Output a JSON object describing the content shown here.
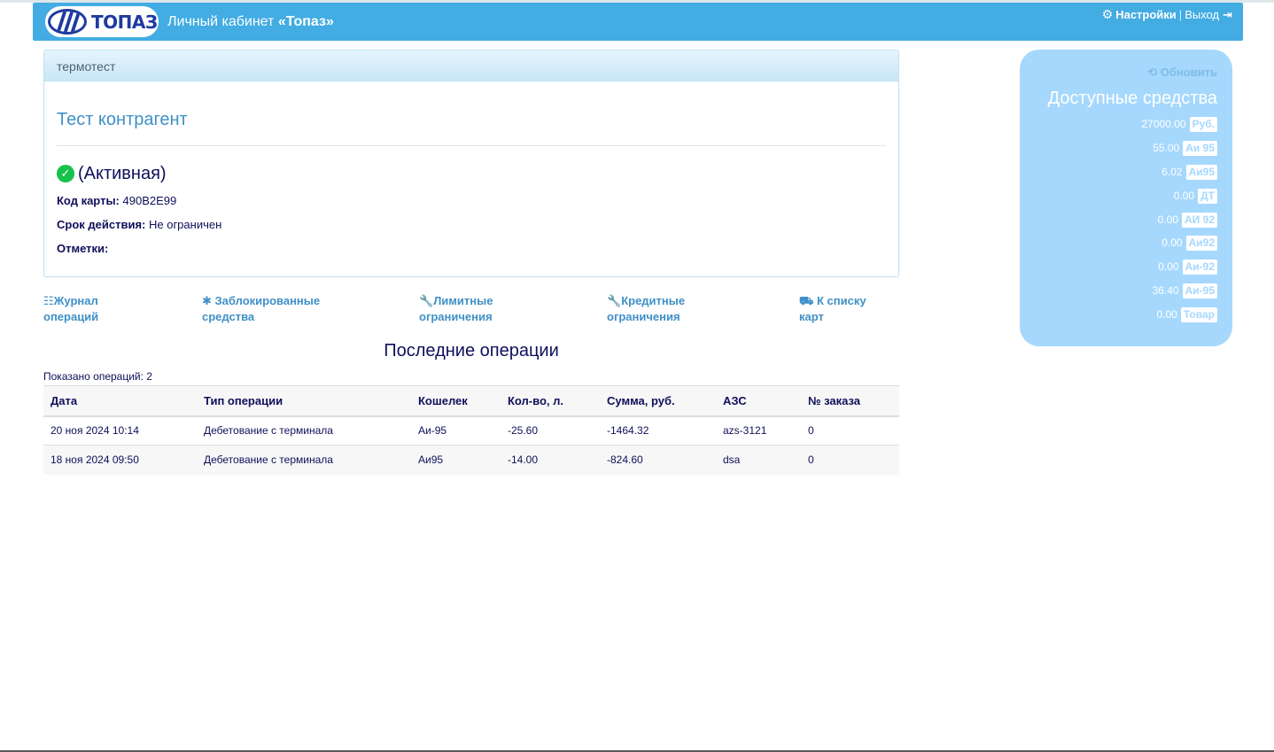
{
  "header": {
    "logo_text": "ТОПАЗ",
    "brand_prefix": "Личный кабинет ",
    "brand_name": "«Топаз»",
    "settings_label": "Настройки",
    "separator": "|",
    "logout_label": "Выход"
  },
  "card": {
    "group_name": "термотест",
    "contractor": "Тест контрагент",
    "status": "(Активная)",
    "code_label": "Код карты:",
    "code_value": "490B2E99",
    "validity_label": "Срок действия:",
    "validity_value": "Не ограничен",
    "notes_label": "Отметки:",
    "notes_value": ""
  },
  "actions": [
    {
      "icon": "list-icon",
      "line1": "Журнал",
      "line2": "операций"
    },
    {
      "icon": "asterisk-icon",
      "line1": "Заблокированные",
      "line2": "средства"
    },
    {
      "icon": "wrench-icon",
      "line1": "Лимитные",
      "line2": "ограничения"
    },
    {
      "icon": "wrench-icon",
      "line1": "Кредитные",
      "line2": "ограничения"
    },
    {
      "icon": "truck-icon",
      "line1": "К списку",
      "line2": "карт"
    }
  ],
  "operations": {
    "title": "Последние операции",
    "count_text": "Показано операций: 2",
    "columns": [
      "Дата",
      "Тип операции",
      "Кошелек",
      "Кол-во, л.",
      "Сумма, руб.",
      "АЗС",
      "№ заказа"
    ],
    "rows": [
      [
        "20 ноя 2024 10:14",
        "Дебетование с терминала",
        "Аи-95",
        "-25.60",
        "-1464.32",
        "azs-3121",
        "0"
      ],
      [
        "18 ноя 2024 09:50",
        "Дебетование с терминала",
        "Аи95",
        "-14.00",
        "-824.60",
        "dsa",
        "0"
      ]
    ]
  },
  "funds": {
    "refresh_label": "Обновить",
    "title": "Доступные средства",
    "items": [
      {
        "amount": "27000.00",
        "label": "Руб."
      },
      {
        "amount": "55.00",
        "label": "Аи 95"
      },
      {
        "amount": "6.02",
        "label": "Аи95"
      },
      {
        "amount": "0.00",
        "label": "ДТ"
      },
      {
        "amount": "0.00",
        "label": "АИ 92"
      },
      {
        "amount": "0.00",
        "label": "Аи92"
      },
      {
        "amount": "0.00",
        "label": "Аи-92"
      },
      {
        "amount": "36.40",
        "label": "Аи-95"
      },
      {
        "amount": "0.00",
        "label": "Товар"
      }
    ]
  },
  "colors": {
    "navbar": "#42ace3",
    "link": "#3f90c8",
    "text": "#0f0f5a",
    "funds_bg": "#a6d8fd",
    "status_ok": "#17c24a"
  }
}
